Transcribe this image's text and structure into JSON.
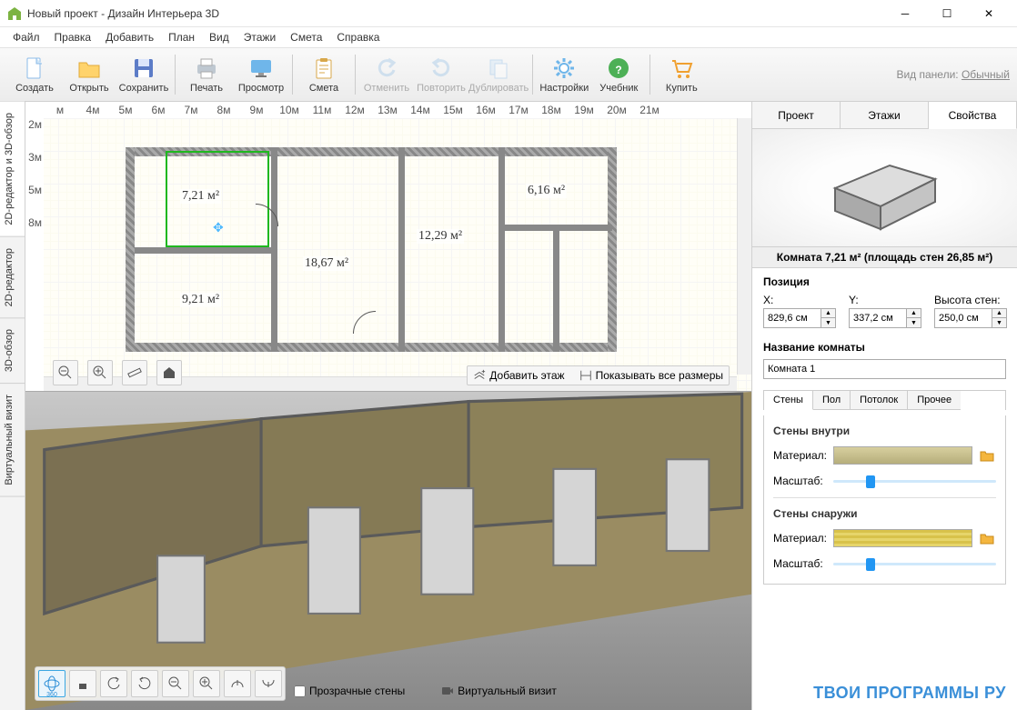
{
  "title": "Новый проект - Дизайн Интерьера 3D",
  "menu": [
    "Файл",
    "Правка",
    "Добавить",
    "План",
    "Вид",
    "Этажи",
    "Смета",
    "Справка"
  ],
  "toolbar": [
    {
      "id": "create",
      "label": "Создать",
      "icon": "doc"
    },
    {
      "id": "open",
      "label": "Открыть",
      "icon": "folder"
    },
    {
      "id": "save",
      "label": "Сохранить",
      "icon": "disk"
    },
    {
      "sep": true
    },
    {
      "id": "print",
      "label": "Печать",
      "icon": "print"
    },
    {
      "id": "preview",
      "label": "Просмотр",
      "icon": "monitor"
    },
    {
      "sep": true
    },
    {
      "id": "estimate",
      "label": "Смета",
      "icon": "clipboard"
    },
    {
      "sep": true
    },
    {
      "id": "undo",
      "label": "Отменить",
      "icon": "undo",
      "dim": true
    },
    {
      "id": "redo",
      "label": "Повторить",
      "icon": "redo",
      "dim": true
    },
    {
      "id": "duplicate",
      "label": "Дублировать",
      "icon": "copy",
      "dim": true
    },
    {
      "sep": true
    },
    {
      "id": "settings",
      "label": "Настройки",
      "icon": "gear"
    },
    {
      "id": "tutorial",
      "label": "Учебник",
      "icon": "help"
    },
    {
      "sep": true
    },
    {
      "id": "buy",
      "label": "Купить",
      "icon": "cart"
    }
  ],
  "panel_mode": {
    "label": "Вид панели:",
    "value": "Обычный"
  },
  "left_tabs": [
    "2D-редактор и 3D-обзор",
    "2D-редактор",
    "3D-обзор",
    "Виртуальный визит"
  ],
  "ruler_x": [
    "м",
    "4м",
    "5м",
    "6м",
    "7м",
    "8м",
    "9м",
    "10м",
    "11м",
    "12м",
    "13м",
    "14м",
    "15м",
    "16м",
    "17м",
    "18м",
    "19м",
    "20м",
    "21м"
  ],
  "ruler_y": [
    "2м",
    "3м",
    "5м",
    "8м"
  ],
  "rooms": {
    "r1": "7,21 м²",
    "r2": "6,16 м²",
    "r3": "12,29 м²",
    "r4": "18,67 м²",
    "r5": "9,21 м²"
  },
  "plan_btns": {
    "add_floor": "Добавить этаж",
    "show_dims": "Показывать все размеры"
  },
  "right": {
    "tabs": [
      "Проект",
      "Этажи",
      "Свойства"
    ],
    "room_caption": "Комната 7,21 м²  (площадь стен 26,85 м²)",
    "position_label": "Позиция",
    "x_label": "X:",
    "y_label": "Y:",
    "wh_label": "Высота стен:",
    "x_val": "829,6 см",
    "y_val": "337,2 см",
    "wh_val": "250,0 см",
    "name_label": "Название комнаты",
    "name_val": "Комната 1",
    "sub_tabs": [
      "Стены",
      "Пол",
      "Потолок",
      "Прочее"
    ],
    "walls_in": "Стены внутри",
    "walls_out": "Стены снаружи",
    "material": "Материал:",
    "scale": "Масштаб:"
  },
  "view_extras": {
    "transparent": "Прозрачные стены",
    "virtual": "Виртуальный визит"
  },
  "watermark": "ТВОИ ПРОГРАММЫ РУ"
}
